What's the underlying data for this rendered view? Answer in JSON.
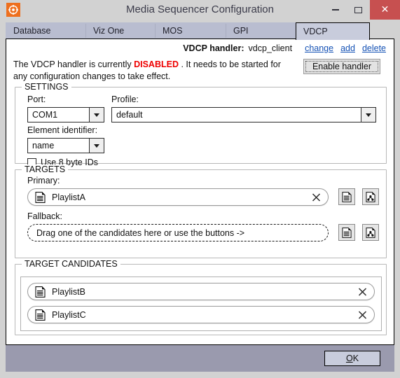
{
  "window": {
    "title": "Media Sequencer Configuration",
    "app_icon": "viz-target-icon",
    "minimize_label": "Minimize",
    "maximize_label": "Maximize",
    "close_label": "Close",
    "close_glyph": "✕",
    "accent_orange": "#ee6f1e",
    "close_red": "#c75050"
  },
  "tabs": [
    {
      "label": "Database",
      "selected": false
    },
    {
      "label": "Viz One",
      "selected": false
    },
    {
      "label": "MOS",
      "selected": false
    },
    {
      "label": "GPI",
      "selected": false
    },
    {
      "label": "VDCP",
      "selected": true
    }
  ],
  "handler": {
    "label": "VDCP handler:",
    "name": "vdcp_client",
    "links": [
      "change",
      "add",
      "delete"
    ],
    "link_color": "#1552b5"
  },
  "status": {
    "text_before": "The VDCP handler is currently ",
    "state": "DISABLED",
    "state_color": "#ee0000",
    "text_after": " . It needs to be started for any configuration  changes to take effect.",
    "enable_button": "Enable handler"
  },
  "settings": {
    "title": "SETTINGS",
    "port_label": "Port:",
    "port_value": "COM1",
    "profile_label": "Profile:",
    "profile_value": "default",
    "element_identifier_label": "Element identifier:",
    "element_identifier_value": "name",
    "use_8_byte_ids_label": "Use 8 byte IDs",
    "use_8_byte_ids_checked": false
  },
  "targets": {
    "title": "TARGETS",
    "primary_label": "Primary:",
    "primary_value": "PlaylistA",
    "fallback_label": "Fallback:",
    "fallback_placeholder": "Drag one of the candidates here or use the buttons ->",
    "clear_glyph": "✕",
    "button_icons": [
      "playlist-document-icon",
      "hierarchy-document-icon"
    ]
  },
  "candidates": {
    "title": "TARGET CANDIDATES",
    "items": [
      {
        "label": "PlaylistB"
      },
      {
        "label": "PlaylistC"
      }
    ]
  },
  "footer": {
    "ok_label": "OK",
    "ok_accelerator": "O"
  }
}
